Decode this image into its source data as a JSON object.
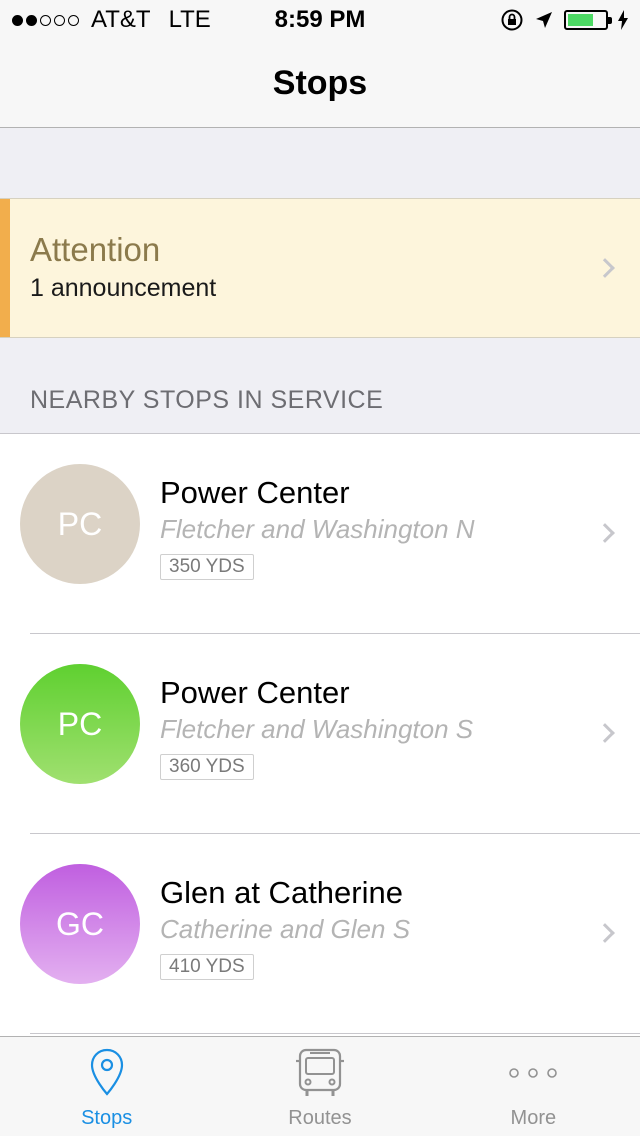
{
  "status_bar": {
    "carrier": "AT&T",
    "network": "LTE",
    "time": "8:59 PM",
    "signal_filled": 2,
    "signal_total": 5,
    "battery_level": 0.7
  },
  "nav": {
    "title": "Stops"
  },
  "attention": {
    "title": "Attention",
    "subtitle": "1 announcement",
    "accent_color": "#f2ae4c"
  },
  "section": {
    "header": "NEARBY STOPS IN SERVICE"
  },
  "stops": [
    {
      "initials": "PC",
      "name": "Power Center",
      "street": "Fletcher and Washington N",
      "distance": "350 YDS",
      "color": "#dcd3c6"
    },
    {
      "initials": "PC",
      "name": "Power Center",
      "street": "Fletcher and Washington S",
      "distance": "360 YDS",
      "color": "#5fd030"
    },
    {
      "initials": "GC",
      "name": "Glen at Catherine",
      "street": "Catherine and Glen S",
      "distance": "410 YDS",
      "color": "#c05fe0"
    }
  ],
  "tabs": [
    {
      "label": "Stops",
      "icon": "location-pin-icon",
      "active": true
    },
    {
      "label": "Routes",
      "icon": "bus-icon",
      "active": false
    },
    {
      "label": "More",
      "icon": "more-dots-icon",
      "active": false
    }
  ],
  "colors": {
    "tab_active": "#1a8fe3",
    "tab_inactive": "#929292"
  }
}
